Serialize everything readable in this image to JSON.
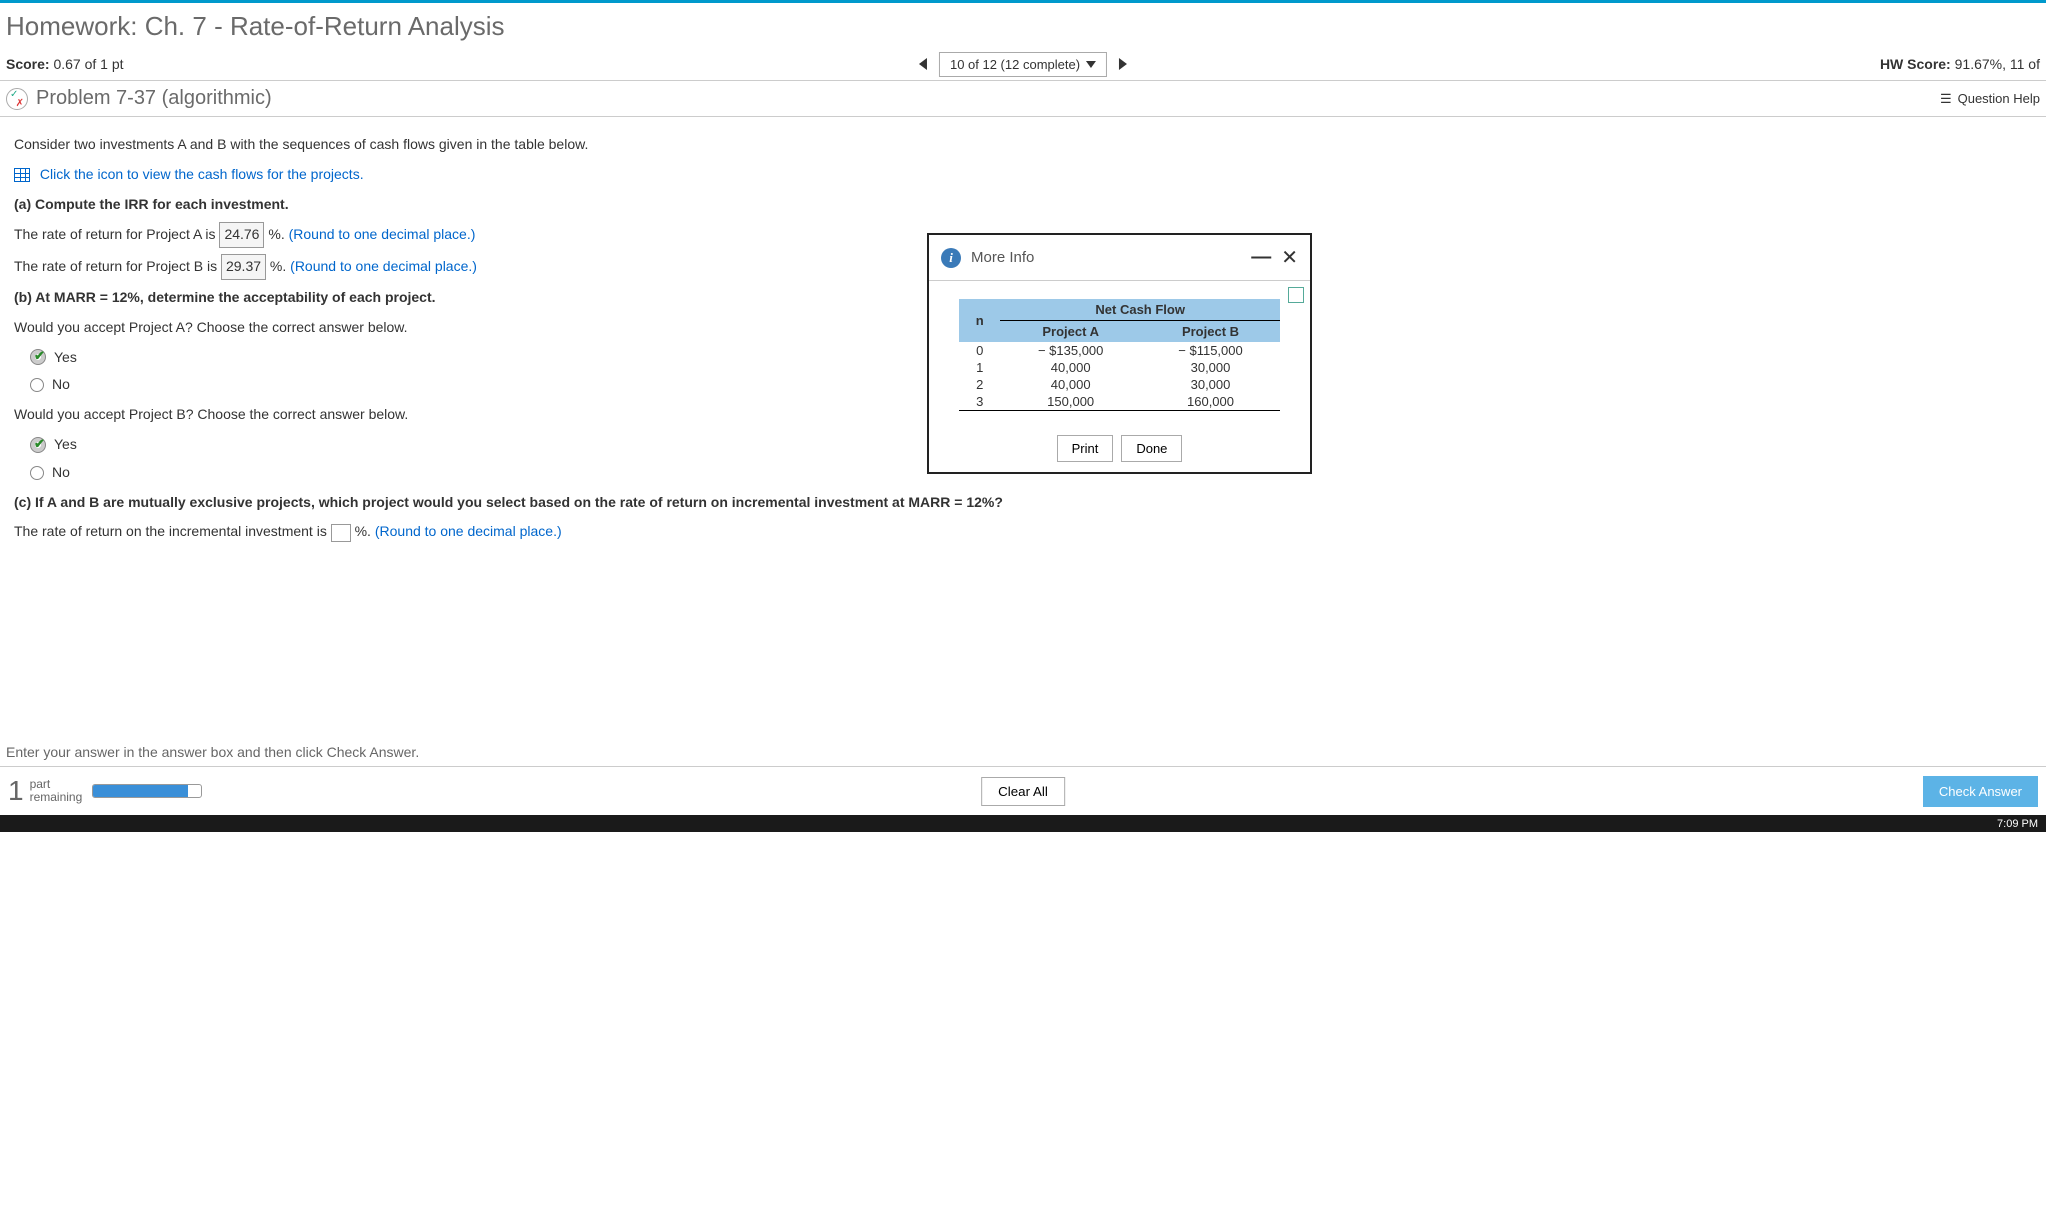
{
  "page_title": "Homework: Ch. 7 - Rate-of-Return Analysis",
  "score": {
    "label": "Score:",
    "value": "0.67 of 1 pt"
  },
  "nav": {
    "position": "10 of 12 (12 complete)"
  },
  "hw_score": {
    "label": "HW Score:",
    "value": "91.67%, 11 of"
  },
  "problem": {
    "title": "Problem 7-37 (algorithmic)",
    "help": "Question Help"
  },
  "body": {
    "intro": "Consider two investments A and B with the sequences of cash flows given in the table below.",
    "cash_link": "Click the icon to view the cash flows for the projects.",
    "part_a": "(a) Compute the IRR for each investment.",
    "ror_a_pre": "The rate of return for Project A is ",
    "ror_a_val": "24.76",
    "ror_b_pre": "The rate of return for Project B is ",
    "ror_b_val": "29.37",
    "pct_unit": " %. ",
    "round_hint": "(Round to one decimal place.)",
    "part_b": "(b) At MARR = 12%, determine the acceptability of each project.",
    "accept_a": "Would you accept Project A? Choose the correct answer below.",
    "accept_b": "Would you accept Project B? Choose the correct answer below.",
    "yes": "Yes",
    "no": "No",
    "part_c": "(c) If A and B are mutually exclusive projects, which project would you select based on the rate of return on incremental investment at MARR = 12%?",
    "incr_pre": "The rate of return on the incremental investment is ",
    "incr_post": " %. "
  },
  "popup": {
    "title": "More Info",
    "header_n": "n",
    "header_ncf": "Net Cash Flow",
    "header_a": "Project A",
    "header_b": "Project B",
    "rows": [
      {
        "n": "0",
        "a": "− $135,000",
        "b": "− $115,000"
      },
      {
        "n": "1",
        "a": "40,000",
        "b": "30,000"
      },
      {
        "n": "2",
        "a": "40,000",
        "b": "30,000"
      },
      {
        "n": "3",
        "a": "150,000",
        "b": "160,000"
      }
    ],
    "print": "Print",
    "done": "Done"
  },
  "footer": {
    "hint": "Enter your answer in the answer box and then click Check Answer.",
    "parts_num": "1",
    "parts_txt1": "part",
    "parts_txt2": "remaining",
    "clear": "Clear All",
    "check": "Check Answer"
  },
  "taskbar": {
    "time": "7:09 PM"
  },
  "chart_data": {
    "type": "table",
    "title": "Net Cash Flow",
    "columns": [
      "n",
      "Project A",
      "Project B"
    ],
    "rows": [
      [
        0,
        -135000,
        -115000
      ],
      [
        1,
        40000,
        30000
      ],
      [
        2,
        40000,
        30000
      ],
      [
        3,
        150000,
        160000
      ]
    ]
  }
}
